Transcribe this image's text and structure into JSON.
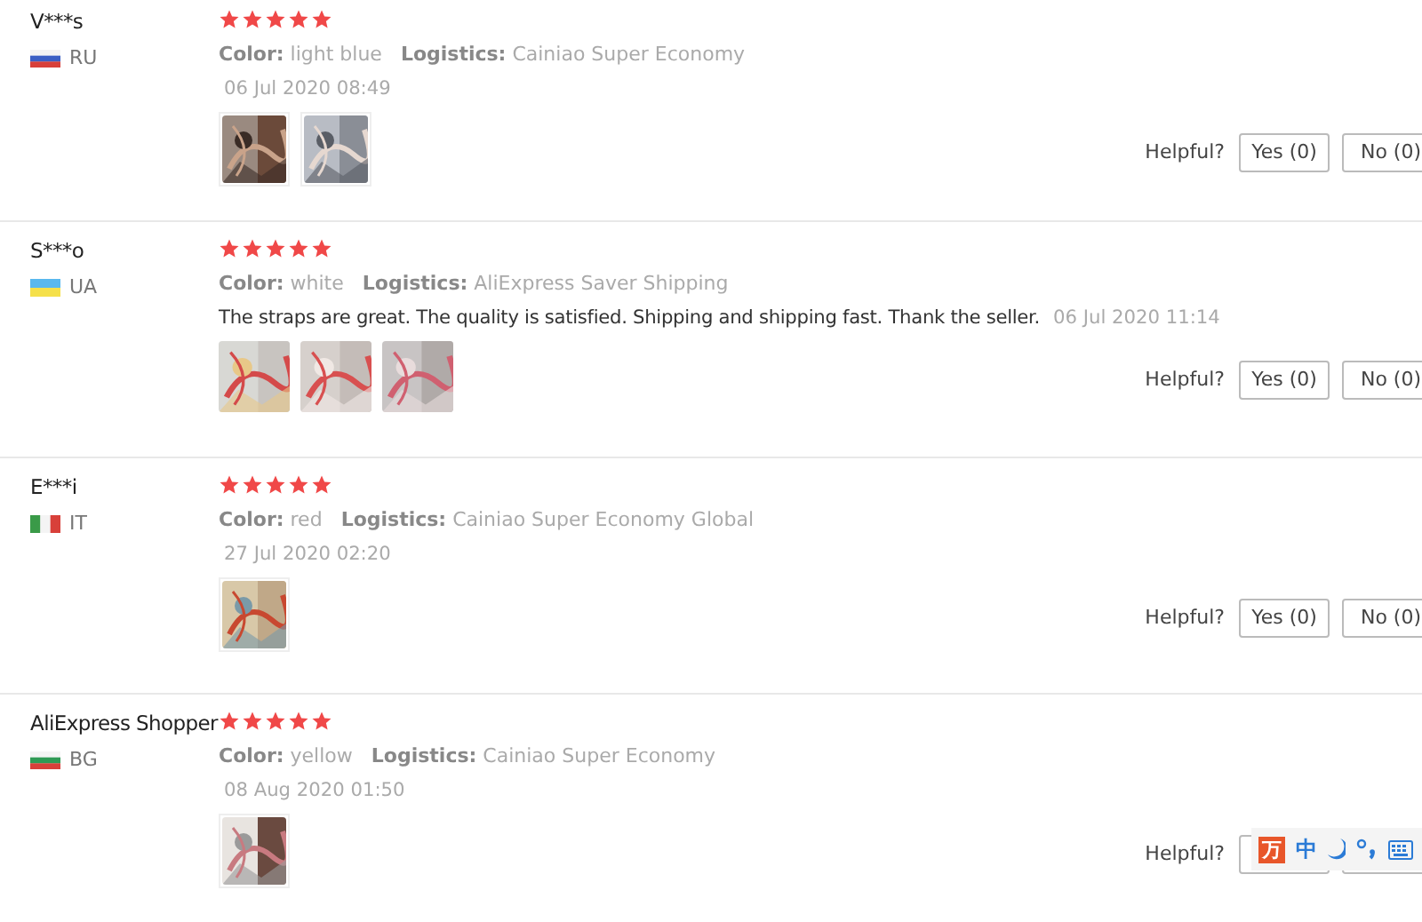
{
  "reviews": [
    {
      "name": "V***s",
      "country": "RU",
      "flag": {
        "kind": "ru"
      },
      "stars": 5,
      "color_label": "Color:",
      "variant": "light blue",
      "logistics_label": "Logistics:",
      "logistics": "Cainiao Super Economy",
      "date": "06 Jul 2020 08:49",
      "photos": [
        {
          "kind": "picture"
        },
        {
          "kind": "picture"
        }
      ],
      "helpful_label": "Helpful?",
      "yes": "Yes (0)",
      "no": "No (0)"
    },
    {
      "name": "S***o",
      "country": "UA",
      "flag": {
        "kind": "ua"
      },
      "stars": 5,
      "color_label": "Color:",
      "variant": "white",
      "logistics_label": "Logistics:",
      "logistics": "AliExpress Saver Shipping",
      "text": "The straps are great. The quality is satisfied. Shipping and shipping fast. Thank the seller.",
      "date": "06 Jul 2020 11:14",
      "photos": [
        {
          "kind": "picture"
        },
        {
          "kind": "picture"
        },
        {
          "kind": "picture"
        }
      ],
      "helpful_label": "Helpful?",
      "yes": "Yes (0)",
      "no": "No (0)"
    },
    {
      "name": "E***i",
      "country": "IT",
      "flag": {
        "kind": "it"
      },
      "stars": 5,
      "color_label": "Color:",
      "variant": "red",
      "logistics_label": "Logistics:",
      "logistics": "Cainiao Super Economy Global",
      "date": "27 Jul 2020 02:20",
      "photos": [
        {
          "kind": "picture"
        }
      ],
      "helpful_label": "Helpful?",
      "yes": "Yes (0)",
      "no": "No (0)"
    },
    {
      "name": "AliExpress Shopper",
      "country": "BG",
      "flag": {
        "kind": "bg"
      },
      "stars": 5,
      "color_label": "Color:",
      "variant": "yellow",
      "logistics_label": "Logistics:",
      "logistics": "Cainiao Super Economy",
      "date": "08 Aug 2020 01:50",
      "photos": [
        {
          "kind": "picture"
        }
      ],
      "helpful_label": "Helpful?"
    }
  ],
  "ime_toolbar": {
    "logo": "万",
    "mode": "中"
  }
}
